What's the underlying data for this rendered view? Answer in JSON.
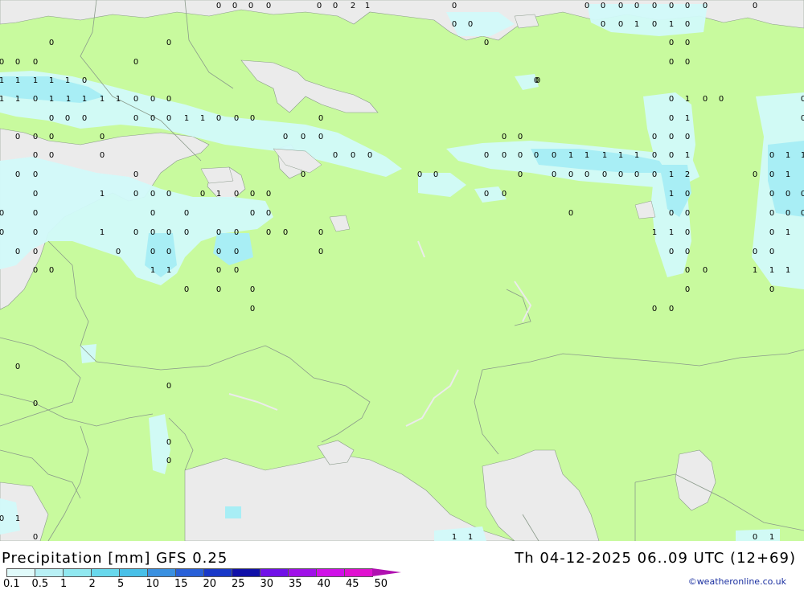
{
  "title_left": "Precipitation [mm] GFS 0.25",
  "title_right": "Th 04-12-2025 06..09 UTC (12+69)",
  "credit": "©weatheronline.co.uk",
  "legend": {
    "labels": [
      "0.1",
      "0.5",
      "1",
      "2",
      "5",
      "10",
      "15",
      "20",
      "25",
      "30",
      "35",
      "40",
      "45",
      "50"
    ],
    "colors": [
      "#e0fafa",
      "#b8f0f5",
      "#90e8f0",
      "#68d8ec",
      "#48c0e8",
      "#3a90e0",
      "#2860d8",
      "#1838c8",
      "#1010a8",
      "#7010e8",
      "#a010e8",
      "#d010e8",
      "#e010d0",
      "#b010b0"
    ]
  },
  "map_colors": {
    "land": "#c8fa9e",
    "sea": "#ebebeb",
    "precip_light": "#d2fafa",
    "precip_medium": "#a8eef5",
    "border": "#8a9a8a"
  },
  "icons": [
    "legend-arrow-icon"
  ],
  "values": [
    "0",
    "0",
    "0",
    "0",
    "0",
    "0",
    "2",
    "1",
    "0",
    "0",
    "0",
    "0",
    "0",
    "0",
    "0",
    "0",
    "0",
    "0",
    "0",
    "0",
    "0",
    "0",
    "1",
    "0",
    "1",
    "0",
    "0",
    "0",
    "0",
    "0",
    "0",
    "0",
    "0",
    "0",
    "0",
    "0",
    "0",
    "0",
    "1",
    "1",
    "1",
    "1",
    "1",
    "0",
    "0",
    "1",
    "1",
    "0",
    "1",
    "1",
    "1",
    "1",
    "1",
    "0",
    "0",
    "0",
    "0",
    "1",
    "0",
    "0",
    "0",
    "0",
    "0",
    "0",
    "0",
    "0",
    "0",
    "1",
    "1",
    "0",
    "0",
    "0",
    "0",
    "0",
    "1",
    "0",
    "0",
    "0",
    "0",
    "0",
    "0",
    "0",
    "0",
    "0",
    "0",
    "0",
    "0",
    "0",
    "0",
    "0",
    "0",
    "0",
    "0",
    "0",
    "0",
    "0",
    "0",
    "0",
    "0",
    "1",
    "1",
    "1",
    "1",
    "1",
    "0",
    "0",
    "1",
    "0",
    "1",
    "1",
    "0",
    "0",
    "0",
    "0",
    "0",
    "0",
    "0",
    "0",
    "0",
    "0",
    "0",
    "0",
    "0",
    "0",
    "1",
    "2",
    "0",
    "0",
    "1",
    "0",
    "1",
    "0",
    "0",
    "0",
    "0",
    "1",
    "0",
    "0",
    "0",
    "0",
    "0",
    "1",
    "0",
    "0",
    "0",
    "0",
    "0",
    "0",
    "0",
    "0",
    "0",
    "0",
    "0",
    "0",
    "0",
    "0",
    "0",
    "0",
    "0",
    "0",
    "1",
    "0",
    "0",
    "0",
    "0",
    "0",
    "0",
    "0",
    "0",
    "0",
    "1",
    "1",
    "0",
    "0",
    "1",
    "0",
    "0",
    "0",
    "0",
    "0",
    "0",
    "0",
    "0",
    "0",
    "0",
    "0",
    "0",
    "0",
    "0",
    "1",
    "1",
    "0",
    "0",
    "0",
    "0",
    "1",
    "1",
    "1",
    "0",
    "0",
    "0",
    "0",
    "0",
    "0",
    "0",
    "0",
    "0",
    "0",
    "0",
    "0",
    "0",
    "0",
    "1",
    "0",
    "1",
    "1",
    "0",
    "1"
  ]
}
